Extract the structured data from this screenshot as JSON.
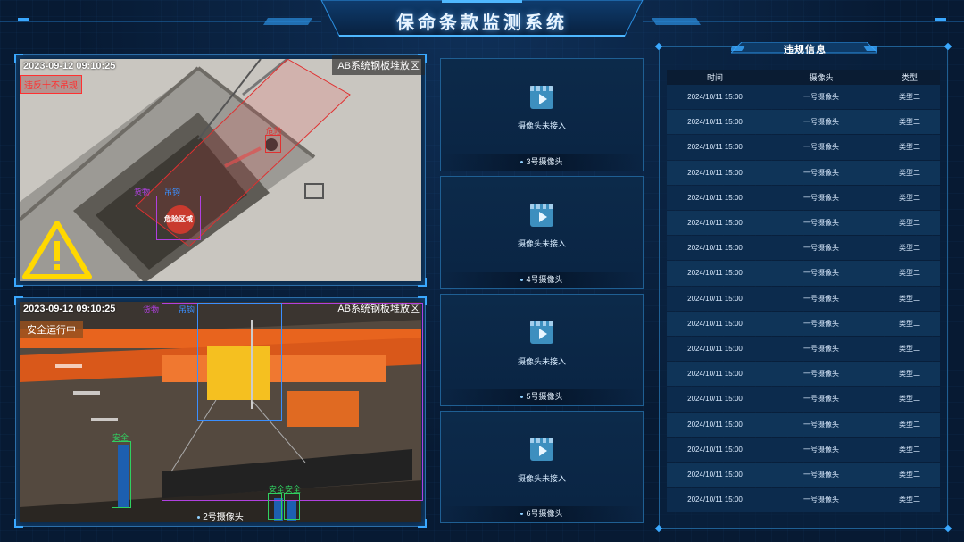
{
  "header": {
    "title": "保命条款监测系统"
  },
  "cameras": {
    "cam1": {
      "timestamp": "2023-09-12 09:10:25",
      "location": "AB系统钢板堆放区",
      "status": "违反十不吊规",
      "detections": [
        "货物",
        "吊钩",
        "危险",
        "危险区域"
      ]
    },
    "cam2": {
      "timestamp": "2023-09-12 09:10:25",
      "location": "AB系统钢板堆放区",
      "status": "安全运行中",
      "detections": [
        "货物",
        "吊钩",
        "安全",
        "安全",
        "安全"
      ],
      "label": "2号摄像头"
    }
  },
  "middle_cameras": [
    {
      "message": "摄像头未接入",
      "label": "3号摄像头"
    },
    {
      "message": "摄像头未接入",
      "label": "4号摄像头"
    },
    {
      "message": "摄像头未接入",
      "label": "5号摄像头"
    },
    {
      "message": "摄像头未接入",
      "label": "6号摄像头"
    }
  ],
  "violations": {
    "title": "违规信息",
    "columns": [
      "时间",
      "摄像头",
      "类型"
    ],
    "rows": [
      [
        "2024/10/11 15:00",
        "一号摄像头",
        "类型二"
      ],
      [
        "2024/10/11 15:00",
        "一号摄像头",
        "类型二"
      ],
      [
        "2024/10/11 15:00",
        "一号摄像头",
        "类型二"
      ],
      [
        "2024/10/11 15:00",
        "一号摄像头",
        "类型二"
      ],
      [
        "2024/10/11 15:00",
        "一号摄像头",
        "类型二"
      ],
      [
        "2024/10/11 15:00",
        "一号摄像头",
        "类型二"
      ],
      [
        "2024/10/11 15:00",
        "一号摄像头",
        "类型二"
      ],
      [
        "2024/10/11 15:00",
        "一号摄像头",
        "类型二"
      ],
      [
        "2024/10/11 15:00",
        "一号摄像头",
        "类型二"
      ],
      [
        "2024/10/11 15:00",
        "一号摄像头",
        "类型二"
      ],
      [
        "2024/10/11 15:00",
        "一号摄像头",
        "类型二"
      ],
      [
        "2024/10/11 15:00",
        "一号摄像头",
        "类型二"
      ],
      [
        "2024/10/11 15:00",
        "一号摄像头",
        "类型二"
      ],
      [
        "2024/10/11 15:00",
        "一号摄像头",
        "类型二"
      ],
      [
        "2024/10/11 15:00",
        "一号摄像头",
        "类型二"
      ],
      [
        "2024/10/11 15:00",
        "一号摄像头",
        "类型二"
      ],
      [
        "2024/10/11 15:00",
        "一号摄像头",
        "类型二"
      ]
    ]
  },
  "colors": {
    "accent": "#3aa8ff",
    "danger": "#ff3030",
    "detect_purple": "#b040e0",
    "detect_blue": "#3a8fff",
    "detect_green": "#30d060",
    "warning_yellow": "#ffd800"
  },
  "icons": {
    "warning": "warning-triangle-icon",
    "play": "video-play-icon"
  }
}
